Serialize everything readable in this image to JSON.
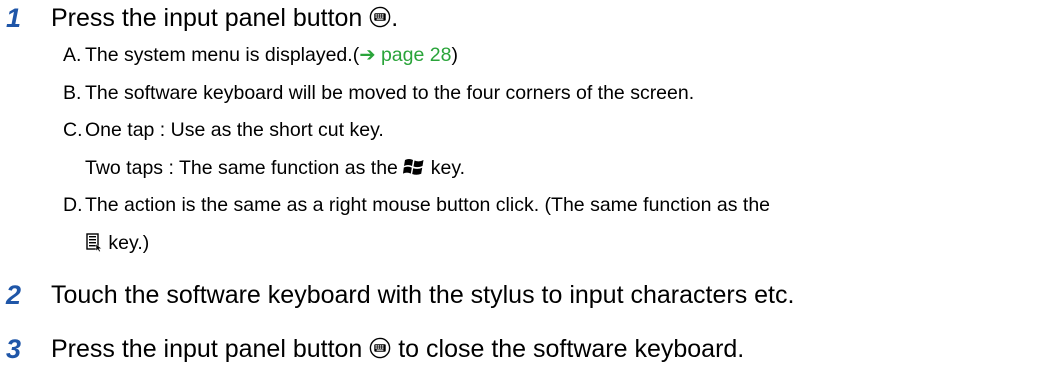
{
  "steps": [
    {
      "number": "1",
      "text_before": "Press the input panel button ",
      "text_after": ".",
      "icon": "input-panel-button-icon",
      "substeps": [
        {
          "letter": "A.",
          "text": "The system menu is displayed.(",
          "link_arrow": "➔",
          "link_text": " page 28",
          "text_end": ")"
        },
        {
          "letter": "B.",
          "text": "The software keyboard will be moved to the four corners of the screen."
        },
        {
          "letter": "C.",
          "text": "One tap : Use as the short cut key.",
          "continuation_before": "Two taps : The same function as the ",
          "continuation_icon": "windows-key-icon",
          "continuation_after": " key."
        },
        {
          "letter": "D.",
          "text": "The action is the same as a right mouse button click. (The same function as the",
          "continuation_icon": "application-key-icon",
          "continuation_after": " key.)"
        }
      ]
    },
    {
      "number": "2",
      "text": "Touch the software keyboard with the stylus to input characters etc."
    },
    {
      "number": "3",
      "text_before": "Press the input panel button ",
      "icon": "input-panel-button-icon",
      "text_after": " to close the software keyboard."
    }
  ],
  "colors": {
    "step_number": "#1f56a8",
    "link": "#2aa43a",
    "text": "#000000"
  }
}
